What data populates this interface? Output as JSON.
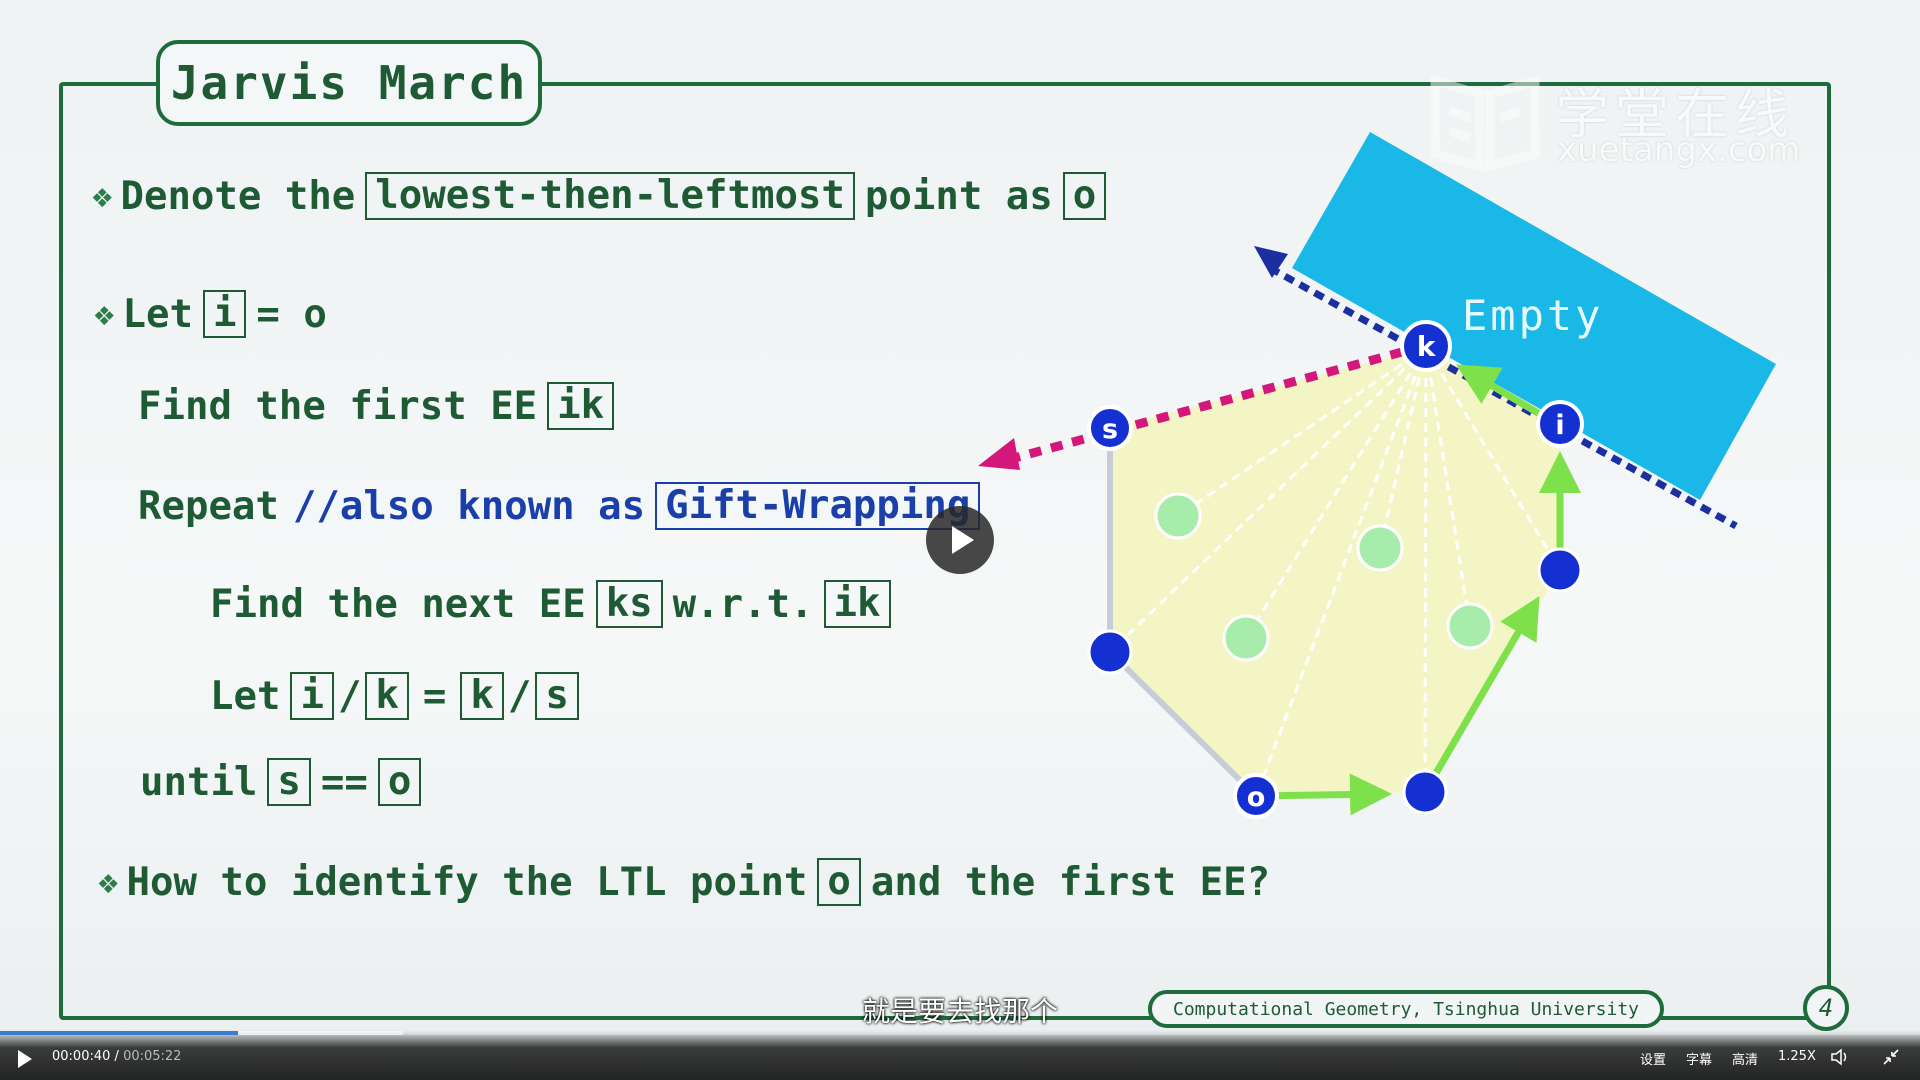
{
  "slide": {
    "title": "Jarvis March",
    "line1": {
      "pre": "Denote the",
      "box1": "lowest-then-leftmost",
      "mid": "point as",
      "box2": "o"
    },
    "line2": {
      "pre": "Let",
      "box": "i",
      "post": "= o"
    },
    "line3": {
      "pre": "Find the first EE",
      "box": "ik"
    },
    "line4": {
      "pre": "Repeat",
      "comment": "//also known as",
      "box": "Gift-Wrapping"
    },
    "line5": {
      "pre": "Find the next EE",
      "box1": "ks",
      "mid": "w.r.t.",
      "box2": "ik"
    },
    "line6": {
      "pre": "Let",
      "box1": "i",
      "slash1": "/",
      "box2": "k",
      "eq": "=",
      "box3": "k",
      "slash2": "/",
      "box4": "s"
    },
    "line7": {
      "pre": "until",
      "box1": "s",
      "eq": "==",
      "box2": "o"
    },
    "line8": {
      "pre": "How to identify the LTL point",
      "box": "o",
      "post": "and the first EE?"
    },
    "footer": "Computational Geometry, Tsinghua University",
    "page_number": "4",
    "bullet_glyph": "❖"
  },
  "diagram": {
    "empty_label": "Empty",
    "labels": {
      "k": "k",
      "s": "s",
      "i": "i",
      "o": "o"
    },
    "colors": {
      "empty_region": "#19b8e6",
      "hull_fill": "#f3f6c4",
      "arrow_green": "#7ee04a",
      "pink": "#d4177a",
      "navy": "#1b2fa0",
      "point_blue": "#1530d0",
      "point_green": "#a8ecab"
    }
  },
  "watermark": {
    "cn": "学堂在线",
    "en": "xuetangx.com"
  },
  "player": {
    "subtitle": "就是要去找那个",
    "current_time": "00:00:40",
    "separator": "/",
    "total_time": "00:05:22",
    "progress_fraction": 0.124,
    "buffered_fraction": 0.21,
    "settings_label": "设置",
    "captions_label": "字幕",
    "quality_label": "高清",
    "speed_label": "1.25X",
    "icons": [
      "play-icon",
      "volume-icon",
      "exit-fullscreen-icon",
      "play-overlay-icon"
    ]
  }
}
